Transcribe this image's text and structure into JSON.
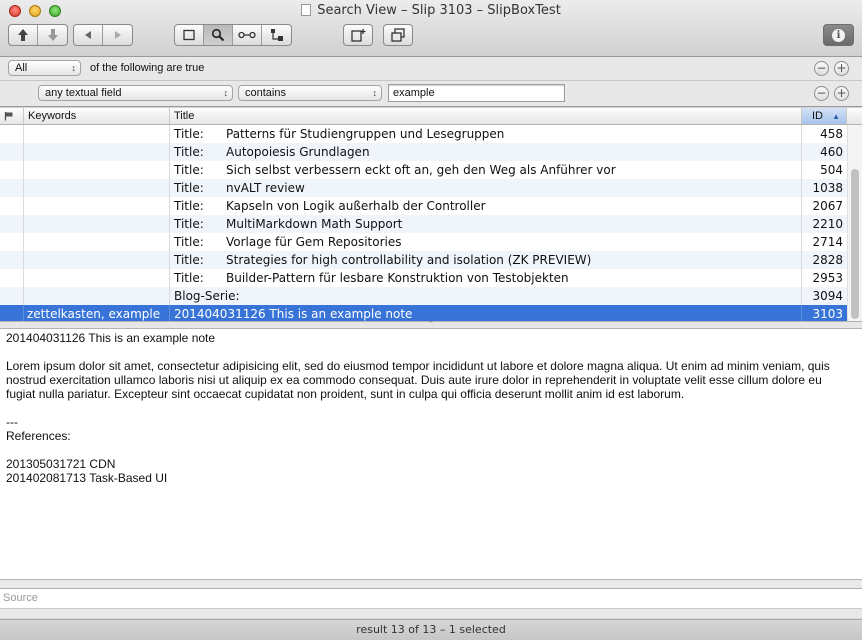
{
  "window": {
    "title": "Search View – Slip 3103 – SlipBoxTest"
  },
  "toolbar": {
    "buttons": [
      "up-arrow-icon",
      "down-arrow-icon",
      "back-icon",
      "forward-icon",
      "single-view-icon",
      "search-icon",
      "link-icon",
      "tree-icon",
      "new-window-icon",
      "duplicate-icon",
      "info-icon"
    ]
  },
  "predicates": {
    "match_mode": "All",
    "match_suffix": "of the following are true",
    "field": "any textual field",
    "operator": "contains",
    "value": "example",
    "remove_label": "−",
    "add_label": "+"
  },
  "table": {
    "columns": {
      "flag": "",
      "keywords": "Keywords",
      "title": "Title",
      "id": "ID"
    },
    "rows": [
      {
        "keywords": "",
        "prefix": "Title:",
        "title": "Patterns für Studiengruppen und Lesegruppen",
        "id": "458"
      },
      {
        "keywords": "",
        "prefix": "Title:",
        "title": "Autopoiesis Grundlagen",
        "id": "460"
      },
      {
        "keywords": "",
        "prefix": "Title:",
        "title": "Sich selbst verbessern eckt oft an, geh den Weg als Anführer vor",
        "id": "504"
      },
      {
        "keywords": "",
        "prefix": "Title:",
        "title": "nvALT review",
        "id": "1038"
      },
      {
        "keywords": "",
        "prefix": "Title:",
        "title": "Kapseln von Logik außerhalb der Controller",
        "id": "2067"
      },
      {
        "keywords": "",
        "prefix": "Title:",
        "title": "MultiMarkdown Math Support",
        "id": "2210"
      },
      {
        "keywords": "",
        "prefix": "Title:",
        "title": "Vorlage für Gem Repositories",
        "id": "2714"
      },
      {
        "keywords": "",
        "prefix": "Title:",
        "title": "Strategies for high controllability and isolation (ZK PREVIEW)",
        "id": "2828"
      },
      {
        "keywords": "",
        "prefix": "Title:",
        "title": "Builder-Pattern für lesbare Konstruktion von Testobjekten",
        "id": "2953"
      },
      {
        "keywords": "",
        "prefix": "Blog-Serie:",
        "title": "",
        "id": "3094"
      },
      {
        "keywords": "zettelkasten, example",
        "prefix": "",
        "title": "201404031126 This is an example note",
        "id": "3103"
      }
    ]
  },
  "note": {
    "line1": "201404031126 This is an example note",
    "para1": "Lorem ipsum dolor sit amet, consectetur adipisicing elit, sed do eiusmod tempor incididunt ut labore et dolore magna aliqua. Ut enim ad minim veniam, quis nostrud exercitation ullamco laboris nisi ut aliquip ex ea commodo consequat. Duis aute irure dolor in reprehenderit in voluptate velit esse cillum dolore eu fugiat nulla pariatur. Excepteur sint occaecat cupidatat non proident, sunt in culpa qui officia deserunt mollit anim id est laborum.",
    "sep": "---",
    "refs_label": "References:",
    "ref1": "201305031721 CDN",
    "ref2": "201402081713 Task-Based UI"
  },
  "source": {
    "placeholder": "Source"
  },
  "status": {
    "text": "result 13 of 13 – 1 selected"
  }
}
